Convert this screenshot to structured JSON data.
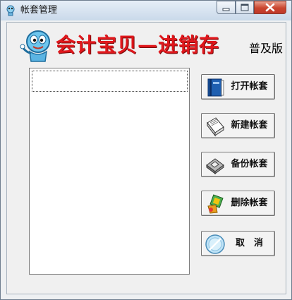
{
  "window": {
    "title": "帐套管理"
  },
  "header": {
    "brand": "会计宝贝—进销存",
    "edition": "普及版"
  },
  "account_list": {
    "items": [
      ""
    ]
  },
  "buttons": {
    "open": "打开帐套",
    "new": "新建帐套",
    "backup": "备份帐套",
    "delete": "删除帐套",
    "cancel": "取　消"
  },
  "icons": {
    "open": "book-icon",
    "new": "notepad-icon",
    "backup": "disk-icon",
    "delete": "eraser-icon",
    "cancel": "cancel-disc-icon"
  }
}
